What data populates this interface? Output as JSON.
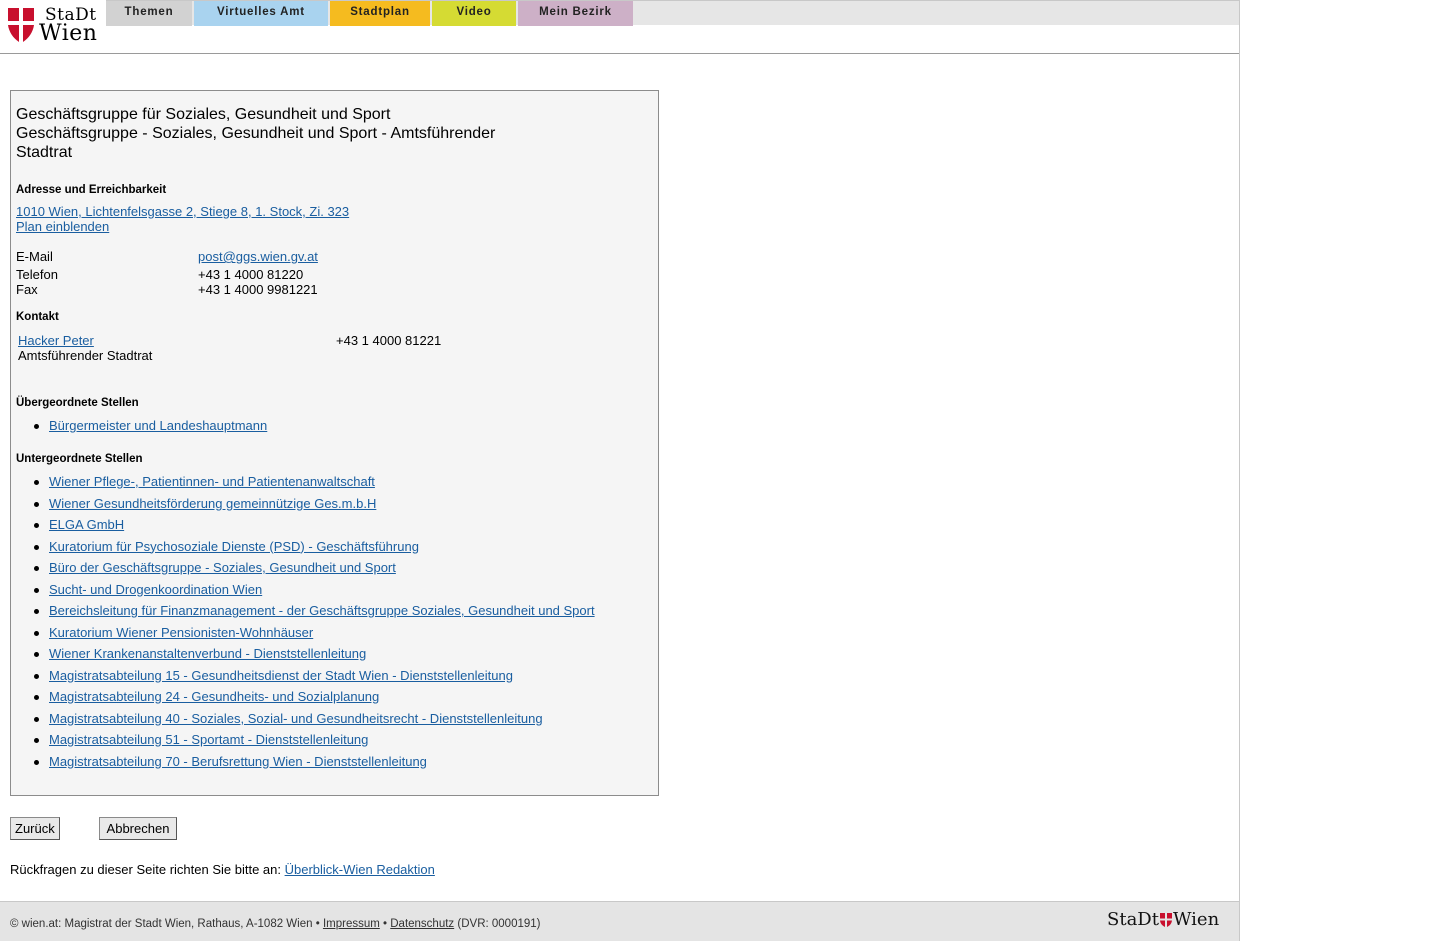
{
  "header": {
    "logo": {
      "line1": "StaDt",
      "line2": "Wien"
    },
    "nav": [
      {
        "label": "Themen",
        "color": "#d2d2d2"
      },
      {
        "label": "Virtuelles Amt",
        "color": "#a9d3ef"
      },
      {
        "label": "Stadtplan",
        "color": "#f5bb1f"
      },
      {
        "label": "Video",
        "color": "#d5db33"
      },
      {
        "label": "Mein Bezirk",
        "color": "#cdb0c7"
      }
    ]
  },
  "org": {
    "title_line1": "Geschäftsgruppe für Soziales, Gesundheit und Sport",
    "title_line2": "Geschäftsgruppe - Soziales, Gesundheit und Sport - Amtsführender",
    "title_line3": "Stadtrat"
  },
  "address": {
    "heading": "Adresse und Erreichbarkeit",
    "street": "1010 Wien, Lichtenfelsgasse 2, Stiege 8, 1. Stock, Zi. 323",
    "plan_link": "Plan einblenden",
    "email_label": "E-Mail",
    "email": "post@ggs.wien.gv.at",
    "phone_label": "Telefon",
    "phone": "+43 1 4000 81220",
    "fax_label": "Fax",
    "fax": "+43 1 4000 9981221"
  },
  "contact": {
    "heading": "Kontakt",
    "name": "Hacker Peter",
    "role": "Amtsführender Stadtrat",
    "phone": "+43 1 4000 81221"
  },
  "superior": {
    "heading": "Übergeordnete Stellen",
    "items": [
      "Bürgermeister und Landeshauptmann"
    ]
  },
  "subordinate": {
    "heading": "Untergeordnete Stellen",
    "items": [
      "Wiener Pflege-, Patientinnen- und Patientenanwaltschaft",
      "Wiener Gesundheitsförderung gemeinnützige Ges.m.b.H",
      "ELGA GmbH",
      "Kuratorium für Psychosoziale Dienste (PSD) - Geschäftsführung",
      "Büro der Geschäftsgruppe - Soziales, Gesundheit und Sport",
      "Sucht- und Drogenkoordination Wien",
      "Bereichsleitung für Finanzmanagement - der Geschäftsgruppe Soziales, Gesundheit und Sport",
      "Kuratorium Wiener Pensionisten-Wohnhäuser",
      "Wiener Krankenanstaltenverbund - Dienststellenleitung",
      "Magistratsabteilung 15 - Gesundheitsdienst der Stadt Wien - Dienststellenleitung",
      "Magistratsabteilung 24 - Gesundheits- und Sozialplanung",
      "Magistratsabteilung 40 - Soziales, Sozial- und Gesundheitsrecht - Dienststellenleitung",
      "Magistratsabteilung 51 - Sportamt - Dienststellenleitung",
      "Magistratsabteilung 70 - Berufsrettung Wien - Dienststellenleitung"
    ]
  },
  "buttons": {
    "back": "Zurück",
    "cancel": "Abbrechen"
  },
  "feedback": {
    "text": "Rückfragen zu dieser Seite richten Sie bitte an: ",
    "link": "Überblick-Wien Redaktion"
  },
  "footer": {
    "prefix": "© wien.at: Magistrat der Stadt Wien, Rathaus, A-1082 Wien •",
    "impressum": "Impressum",
    "sep": "•",
    "datenschutz": "Datenschutz",
    "dvr": "(DVR: 0000191)",
    "logo_left": "StaDt",
    "logo_right": "Wien"
  },
  "colors": {
    "link": "#1a5ea0",
    "shield_red": "#c8102e"
  },
  "icons": {
    "logo": "vienna-shield-icon"
  }
}
